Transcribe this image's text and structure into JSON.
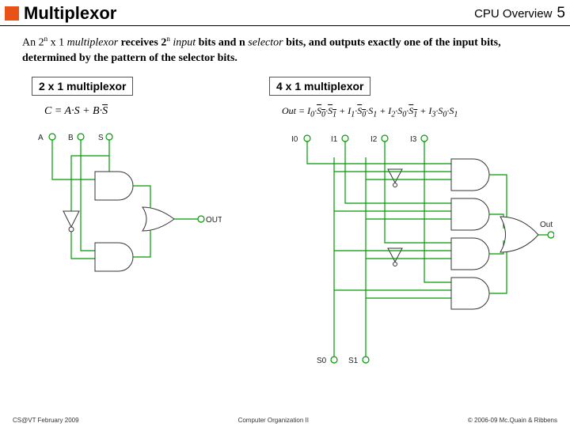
{
  "header": {
    "title": "Multiplexor",
    "subtitle": "CPU Overview",
    "page_number": "5"
  },
  "description": {
    "p1_a": "An 2",
    "p1_sup1": "n",
    "p1_b": " x 1 ",
    "p1_term1": "multiplexor",
    "p1_c": " receives 2",
    "p1_sup2": "n",
    "p1_d": " ",
    "p1_term2": "input",
    "p1_e": " bits and n ",
    "p1_term3": "selector",
    "p1_f": " bits, and outputs exactly one of the input bits, determined by the pattern of the selector bits."
  },
  "left": {
    "title": "2 x 1 multiplexor",
    "equation_html": "C = A·S + B·<span class='overline'>S</span>",
    "labels": {
      "A": "A",
      "B": "B",
      "S": "S",
      "Out": "OUT"
    }
  },
  "right": {
    "title": "4 x 1 multiplexor",
    "equation_html": "Out = I<sub>0</sub>·<span class='overline'>S<sub>0</sub></span>·<span class='overline'>S<sub>1</sub></span> + I<sub>1</sub>·<span class='overline'>S<sub>0</sub></span>·S<sub>1</sub> + I<sub>2</sub>·S<sub>0</sub>·<span class='overline'>S<sub>1</sub></span> + I<sub>3</sub>·S<sub>0</sub>·S<sub>1</sub>",
    "labels": {
      "I0": "I0",
      "I1": "I1",
      "I2": "I2",
      "I3": "I3",
      "S0": "S0",
      "S1": "S1",
      "Out": "Out"
    }
  },
  "footer": {
    "left": "CS@VT February 2009",
    "center": "Computer Organization II",
    "right": "© 2006-09 Mc.Quain & Ribbens"
  },
  "chart_data": {
    "type": "table",
    "title": "Multiplexor logic circuits",
    "items": [
      {
        "name": "2x1 multiplexor",
        "inputs": [
          "A",
          "B"
        ],
        "selectors": [
          "S"
        ],
        "output": "C",
        "formula": "C = A·S + B·not(S)"
      },
      {
        "name": "4x1 multiplexor",
        "inputs": [
          "I0",
          "I1",
          "I2",
          "I3"
        ],
        "selectors": [
          "S0",
          "S1"
        ],
        "output": "Out",
        "formula": "Out = I0·not(S0)·not(S1) + I1·not(S0)·S1 + I2·S0·not(S1) + I3·S0·S1"
      }
    ]
  }
}
